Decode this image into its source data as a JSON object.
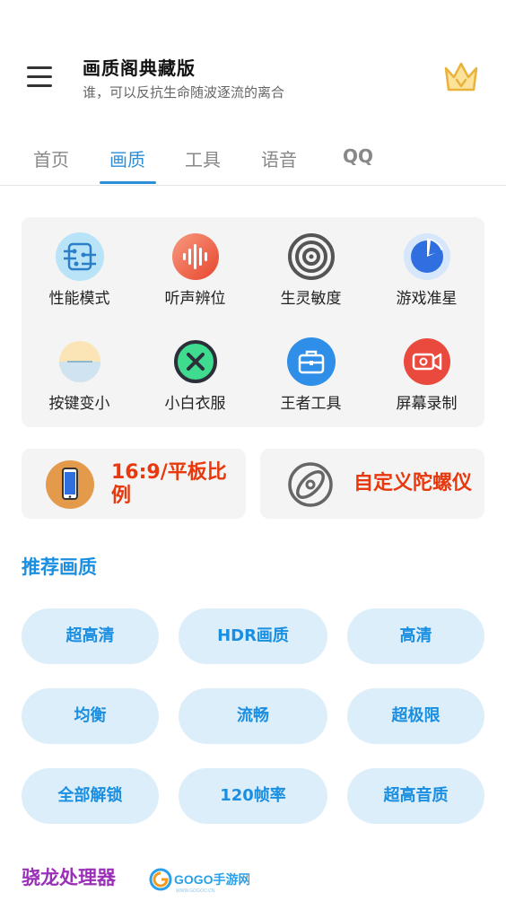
{
  "header": {
    "title": "画质阁典藏版",
    "subtitle": "谁，可以反抗生命随波逐流的离合"
  },
  "tabs": [
    {
      "label": "首页"
    },
    {
      "label": "画质"
    },
    {
      "label": "工具"
    },
    {
      "label": "语音"
    },
    {
      "label": "QQ"
    }
  ],
  "active_tab": "画质",
  "tools": [
    {
      "label": "性能模式",
      "icon": "chip-icon"
    },
    {
      "label": "听声辨位",
      "icon": "sound-wave-icon"
    },
    {
      "label": "生灵敏度",
      "icon": "target-icon"
    },
    {
      "label": "游戏准星",
      "icon": "crosshair-pie-icon"
    },
    {
      "label": "按键变小",
      "icon": "minus-circle-icon"
    },
    {
      "label": "小白衣服",
      "icon": "close-circle-icon"
    },
    {
      "label": "王者工具",
      "icon": "toolbox-icon"
    },
    {
      "label": "屏幕录制",
      "icon": "video-camera-icon"
    }
  ],
  "cards": [
    {
      "label": "16:9/平板比例",
      "icon": "phone-icon"
    },
    {
      "label": "自定义陀螺仪",
      "icon": "gyroscope-icon"
    }
  ],
  "recommend": {
    "title": "推荐画质",
    "items": [
      "超高清",
      "HDR画质",
      "高清",
      "均衡",
      "流畅",
      "超极限",
      "全部解锁",
      "120帧率",
      "超高音质"
    ]
  },
  "next_section": {
    "title": "骁龙处理器"
  },
  "watermark": {
    "text": "GOGO手游网",
    "small": "WWW.GOGOO.CN"
  },
  "colors": {
    "accent": "#2a8fd8",
    "card_text": "#e8380d",
    "section_blue": "#1a8ee0",
    "section_purple": "#9b30b8",
    "pill_bg": "#ddeefb"
  }
}
